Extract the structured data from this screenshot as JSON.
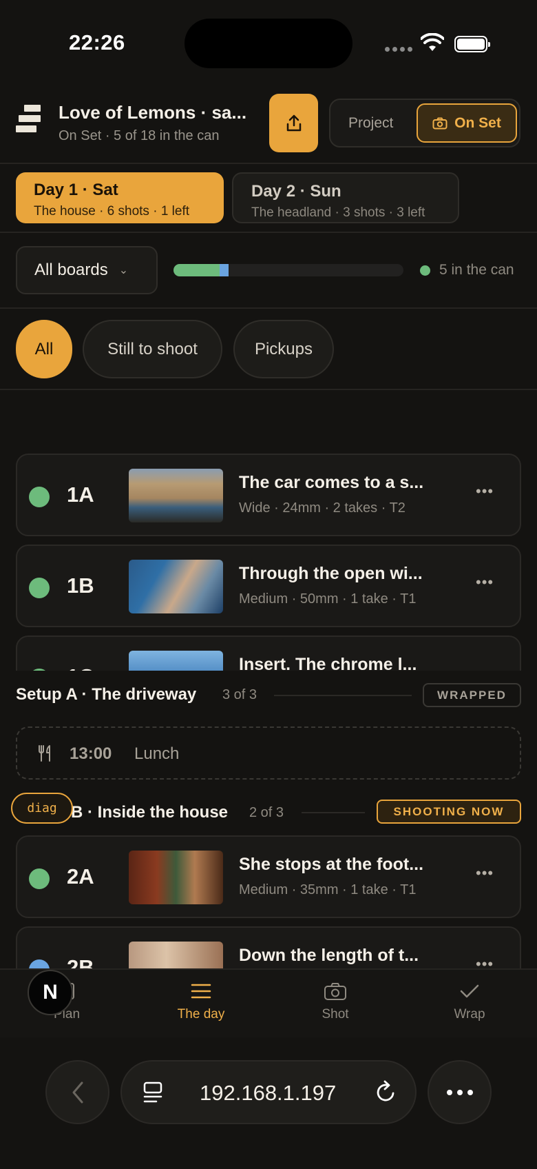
{
  "status": {
    "time": "22:26"
  },
  "header": {
    "project_title": "Love of Lemons · sa...",
    "project_sub": "On Set · 5 of 18 in the can",
    "mode_project": "Project",
    "mode_onset": "On Set"
  },
  "days": [
    {
      "title": "Day 1 · Sat",
      "sub": "The house · 6 shots · 1 left"
    },
    {
      "title": "Day 2 · Sun",
      "sub": "The headland · 3 shots · 3 left"
    }
  ],
  "boards": {
    "label": "All boards",
    "in_can": "5 in the can",
    "progress_done": 0.2,
    "progress_active": 0.04
  },
  "filters": {
    "all": "All",
    "still": "Still to shoot",
    "pickups": "Pickups"
  },
  "setup_a": {
    "title": "Setup A · The driveway",
    "count": "3 of 3",
    "status": "WRAPPED"
  },
  "setup_b": {
    "title": "B · Inside the house",
    "count": "2 of 3",
    "status": "SHOOTING NOW"
  },
  "lunch": {
    "time": "13:00",
    "label": "Lunch"
  },
  "diag_label": "diag",
  "shots": [
    {
      "num": "1A",
      "title": "The car comes to a s...",
      "meta": "Wide · 24mm · 2 takes · T2"
    },
    {
      "num": "1B",
      "title": "Through the open wi...",
      "meta": "Medium · 50mm · 1 take · T1"
    },
    {
      "num": "1C",
      "title": "Insert. The chrome l...",
      "meta": ""
    },
    {
      "num": "2A",
      "title": "She stops at the foot...",
      "meta": "Medium · 35mm · 1 take · T1"
    },
    {
      "num": "2B",
      "title": "Down the length of t...",
      "meta": ""
    }
  ],
  "tabbar": {
    "plan": "Plan",
    "day": "The day",
    "shot": "Shot",
    "wrap": "Wrap",
    "badge": "N"
  },
  "browser": {
    "url": "192.168.1.197"
  },
  "colors": {
    "accent": "#e9a53c",
    "done": "#6dbb7c",
    "active": "#6aa4e0",
    "bg": "#141311"
  }
}
